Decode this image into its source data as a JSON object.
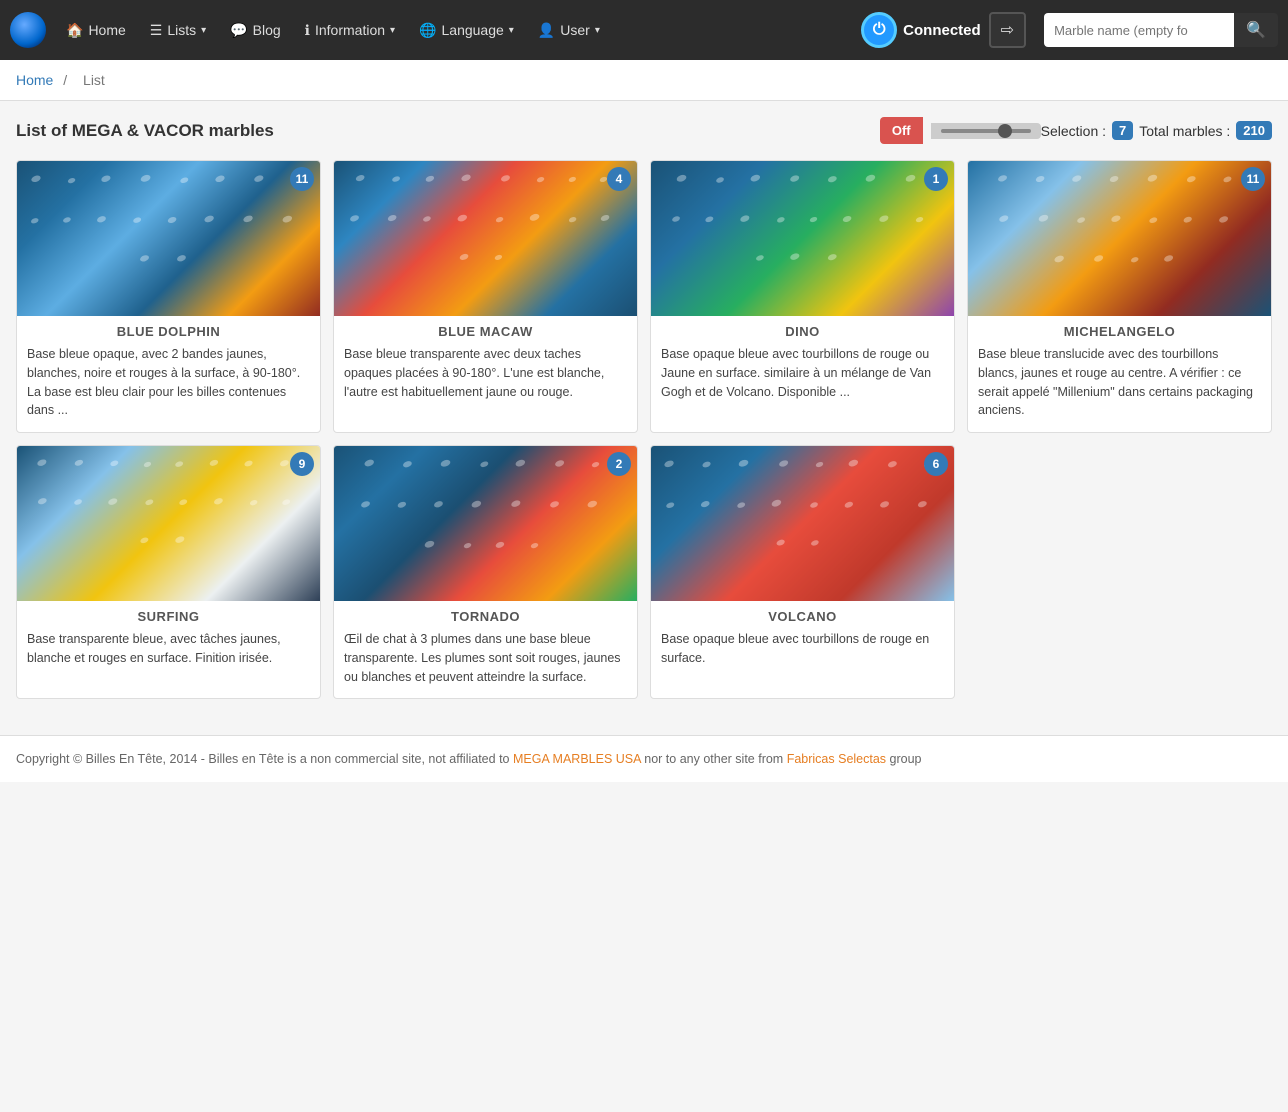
{
  "navbar": {
    "brand_icon": "🔵",
    "items": [
      {
        "id": "home",
        "icon": "🏠",
        "label": "Home",
        "dropdown": false
      },
      {
        "id": "lists",
        "icon": "☰",
        "label": "Lists",
        "dropdown": true
      },
      {
        "id": "blog",
        "icon": "💬",
        "label": "Blog",
        "dropdown": false
      },
      {
        "id": "information",
        "icon": "ℹ",
        "label": "Information",
        "dropdown": true
      },
      {
        "id": "language",
        "icon": "🌐",
        "label": "Language",
        "dropdown": true
      },
      {
        "id": "user",
        "icon": "👤",
        "label": "User",
        "dropdown": true
      }
    ],
    "connected_label": "Connected",
    "search_placeholder": "Marble name (empty fo"
  },
  "breadcrumb": {
    "home_label": "Home",
    "separator": "/",
    "current": "List"
  },
  "toolbar": {
    "page_title": "List of MEGA & VACOR marbles",
    "toggle_label": "Off",
    "selection_label": "Selection :",
    "selection_count": "7",
    "total_label": "Total marbles :",
    "total_count": "210"
  },
  "cards": [
    {
      "id": "blue-dolphin",
      "name": "BLUE DOLPHIN",
      "count": 11,
      "color_class": "marble-blue-dolphin",
      "description": "Base bleue opaque, avec 2 bandes jaunes, blanches, noire et rouges à la surface, à 90-180°. La base est bleu clair pour les billes contenues dans ..."
    },
    {
      "id": "blue-macaw",
      "name": "BLUE MACAW",
      "count": 4,
      "color_class": "marble-blue-macaw",
      "description": "Base bleue transparente avec deux taches opaques placées à 90-180°. L'une est blanche, l'autre est habituellement jaune ou rouge."
    },
    {
      "id": "dino",
      "name": "DINO",
      "count": 1,
      "color_class": "marble-dino",
      "description": "Base opaque bleue avec tourbillons de rouge ou Jaune en surface. similaire à un mélange de Van Gogh et de Volcano. Disponible ..."
    },
    {
      "id": "michelangelo",
      "name": "MICHELANGELO",
      "count": 11,
      "color_class": "marble-michelangelo",
      "description": "Base bleue translucide avec des tourbillons blancs, jaunes et rouge au centre. A vérifier : ce serait appelé \"Millenium\" dans certains packaging anciens."
    },
    {
      "id": "surfing",
      "name": "SURFING",
      "count": 9,
      "color_class": "marble-surfing",
      "description": "Base transparente bleue, avec tâches jaunes, blanche et rouges en surface. Finition irisée."
    },
    {
      "id": "tornado",
      "name": "TORNADO",
      "count": 2,
      "color_class": "marble-tornado",
      "description": "Œil de chat à 3 plumes dans une base bleue transparente. Les plumes sont soit rouges, jaunes ou blanches et peuvent atteindre la surface."
    },
    {
      "id": "volcano",
      "name": "VOLCANO",
      "count": 6,
      "color_class": "marble-volcano",
      "description": "Base opaque bleue avec tourbillons de rouge en surface."
    }
  ],
  "footer": {
    "text_prefix": "Copyright © Billes En Tête, 2014 - Billes en Tête is a non commercial site, not affiliated to ",
    "link1_label": "MEGA MARBLES USA",
    "link1_url": "#",
    "text_middle": " nor to any other site from ",
    "link2_label": "Fabricas Selectas",
    "link2_url": "#",
    "text_suffix": " group"
  }
}
